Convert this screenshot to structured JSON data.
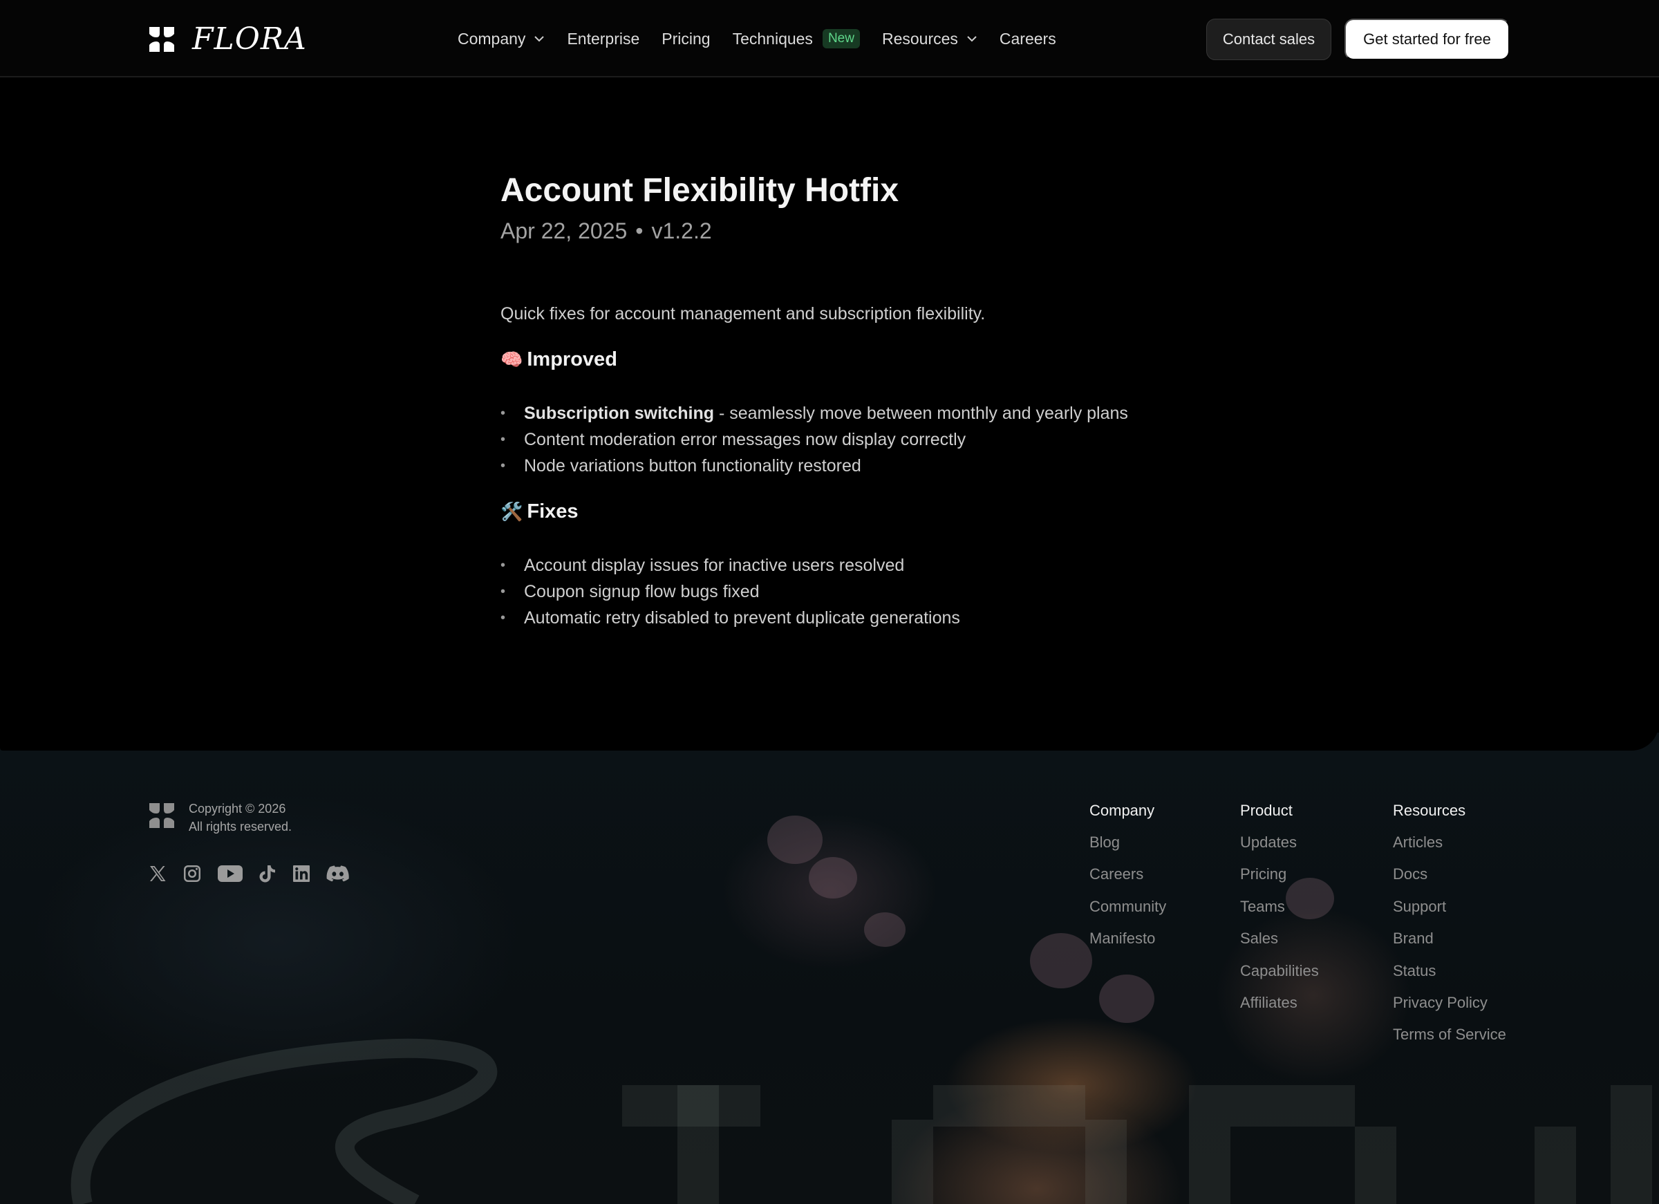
{
  "nav": {
    "logo_text": "FLORA",
    "links": [
      {
        "label": "Company",
        "has_dropdown": true
      },
      {
        "label": "Enterprise",
        "has_dropdown": false
      },
      {
        "label": "Pricing",
        "has_dropdown": false
      },
      {
        "label": "Techniques",
        "has_dropdown": false,
        "badge": "New"
      },
      {
        "label": "Resources",
        "has_dropdown": true
      },
      {
        "label": "Careers",
        "has_dropdown": false
      }
    ],
    "contact_label": "Contact sales",
    "cta_label": "Get started for free"
  },
  "article": {
    "title": "Account Flexibility Hotfix",
    "date": "Apr 22, 2025",
    "version": "v1.2.2",
    "intro": "Quick fixes for account management and subscription flexibility.",
    "improved": {
      "emoji": "🧠",
      "heading": "Improved",
      "items": [
        {
          "bold": "Subscription switching",
          "text": " - seamlessly move between monthly and yearly plans"
        },
        {
          "bold": "",
          "text": "Content moderation error messages now display correctly"
        },
        {
          "bold": "",
          "text": "Node variations button functionality restored"
        }
      ]
    },
    "fixes": {
      "emoji": "🛠️",
      "heading": "Fixes",
      "items": [
        {
          "bold": "",
          "text": "Account display issues for inactive users resolved"
        },
        {
          "bold": "",
          "text": "Coupon signup flow bugs fixed"
        },
        {
          "bold": "",
          "text": "Automatic retry disabled to prevent duplicate generations"
        }
      ]
    }
  },
  "footer": {
    "copyright_line1": "Copyright © 2026",
    "copyright_line2": "All rights reserved.",
    "socials": [
      "x-icon",
      "instagram-icon",
      "youtube-icon",
      "tiktok-icon",
      "linkedin-icon",
      "discord-icon"
    ],
    "columns": [
      {
        "heading": "Company",
        "items": [
          "Blog",
          "Careers",
          "Community",
          "Manifesto"
        ]
      },
      {
        "heading": "Product",
        "items": [
          "Updates",
          "Pricing",
          "Teams",
          "Sales",
          "Capabilities",
          "Affiliates"
        ]
      },
      {
        "heading": "Resources",
        "items": [
          "Articles",
          "Docs",
          "Support",
          "Brand",
          "Status",
          "Privacy Policy",
          "Terms of Service"
        ]
      }
    ]
  },
  "colors": {
    "background": "#000000",
    "badge_bg": "#173a23",
    "badge_text": "#5fd68a",
    "cta_bg": "#ffffff"
  }
}
